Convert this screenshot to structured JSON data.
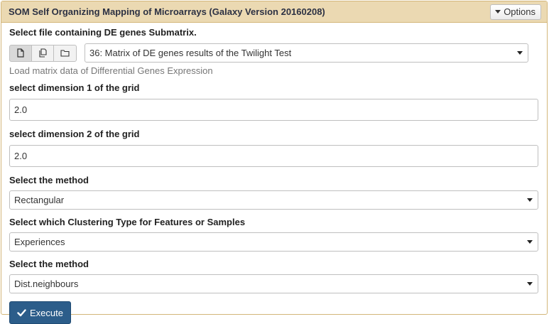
{
  "tool": {
    "title": "SOM Self Organizing Mapping of Microarrays (Galaxy Version 20160208)",
    "options_label": "Options"
  },
  "fields": {
    "file": {
      "label": "Select file containing DE genes Submatrix.",
      "value": "36: Matrix of DE genes results of the Twilight Test",
      "help": "Load matrix data of Differential Genes Expression"
    },
    "dim1": {
      "label": "select dimension 1 of the grid",
      "value": "2.0"
    },
    "dim2": {
      "label": "select dimension 2 of the grid",
      "value": "2.0"
    },
    "method": {
      "label": "Select the method",
      "value": "Rectangular"
    },
    "clustering": {
      "label": "Select which Clustering Type for Features or Samples",
      "value": "Experiences"
    },
    "method2": {
      "label": "Select the method",
      "value": "Dist.neighbours"
    }
  },
  "execute_label": "Execute",
  "colors": {
    "header_bg": "#ebd9b2",
    "border": "#d3b67a",
    "execute_bg": "#2c5d8a"
  }
}
